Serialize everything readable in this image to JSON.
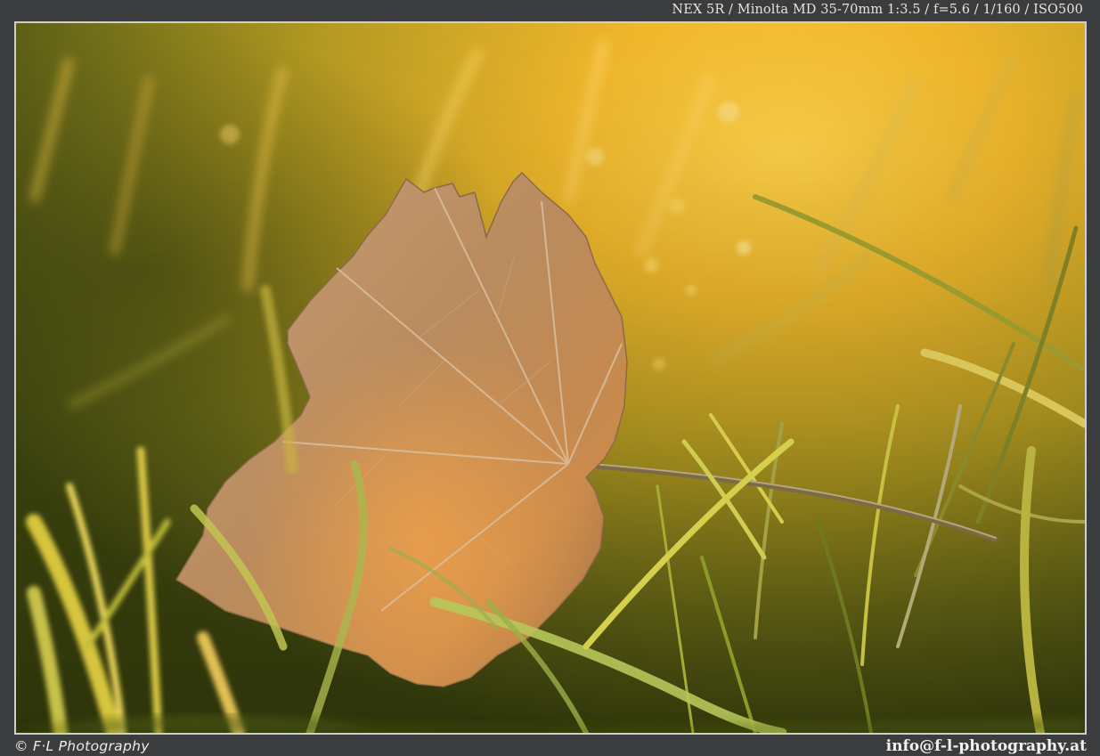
{
  "exif": {
    "text": "NEX 5R / Minolta MD 35-70mm 1:3.5 / f=5.6 / 1/160 / ISO500"
  },
  "photo": {
    "subject": "dry-leaf",
    "palette": {
      "glow": "#ffc23a",
      "grass_dark": "#3d4610",
      "grass_light": "#d8c53a",
      "leaf": "#b88a5a",
      "leaf_glow": "#e79a4a"
    }
  },
  "footer": {
    "copyright": "© F·L Photography",
    "email": "info@f-l-photography.at"
  }
}
